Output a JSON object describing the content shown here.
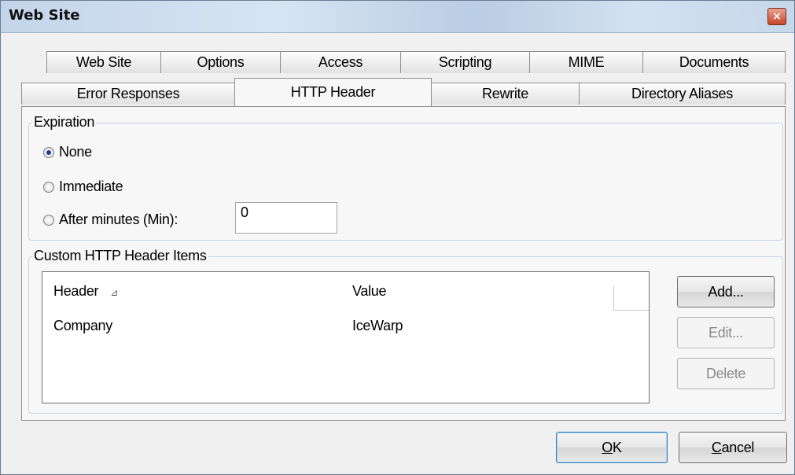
{
  "window": {
    "title": "Web Site",
    "close_glyph": "×"
  },
  "tabs_row1": [
    "Web Site",
    "Options",
    "Access",
    "Scripting",
    "MIME",
    "Documents"
  ],
  "tabs_row2": [
    "Error Responses",
    "HTTP Header",
    "Rewrite",
    "Directory Aliases"
  ],
  "active_tab": "HTTP Header",
  "expiration": {
    "legend": "Expiration",
    "options": [
      {
        "label": "None",
        "checked": true
      },
      {
        "label": "Immediate",
        "checked": false
      },
      {
        "label": "After minutes (Min):",
        "checked": false
      }
    ],
    "minutes_value": "0"
  },
  "custom_headers": {
    "legend": "Custom HTTP Header Items",
    "columns": {
      "header": "Header",
      "value": "Value",
      "sort_glyph": "⊿"
    },
    "rows": [
      {
        "header": "Company",
        "value": "IceWarp"
      }
    ],
    "buttons": {
      "add": "Add...",
      "edit": "Edit...",
      "delete": "Delete"
    }
  },
  "dialog_buttons": {
    "ok_mnemonic": "O",
    "ok_rest": "K",
    "cancel_mnemonic": "C",
    "cancel_rest": "ancel"
  }
}
